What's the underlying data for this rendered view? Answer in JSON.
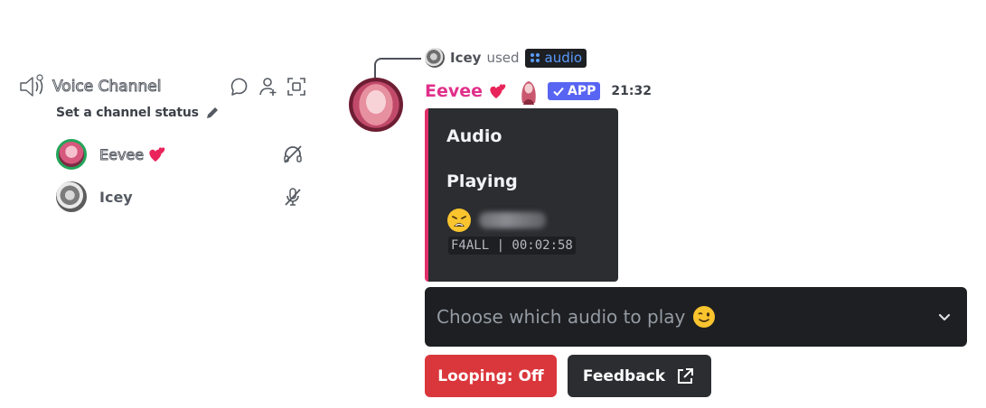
{
  "voice_channel": {
    "name": "Voice Channel",
    "status_prompt": "Set a channel status",
    "icons": [
      "speaker-icon",
      "activity-icon",
      "add-member-icon",
      "fullscreen-icon"
    ],
    "members": [
      {
        "name": "Eevee",
        "speaking": true,
        "icon": "deafened-icon"
      },
      {
        "name": "Icey",
        "speaking": false,
        "icon": "muted-mic-icon"
      }
    ]
  },
  "message": {
    "reply": {
      "user": "Icey",
      "used_text": "used",
      "command": "audio"
    },
    "author": "Eevee",
    "badge": "APP",
    "timestamp": "21:32",
    "embed": {
      "title": "Audio",
      "field_name": "Playing",
      "code": "F4ALL | 00:02:58",
      "accent_color": "#e0306a"
    },
    "select": {
      "placeholder": "Choose which audio to play"
    },
    "buttons": {
      "looping": "Looping: Off",
      "feedback": "Feedback"
    }
  },
  "colors": {
    "author": "#e0308a",
    "app_badge": "#5865f2",
    "danger_button": "#da373c",
    "secondary_button": "#2b2d31",
    "command": "#5a9cff"
  }
}
